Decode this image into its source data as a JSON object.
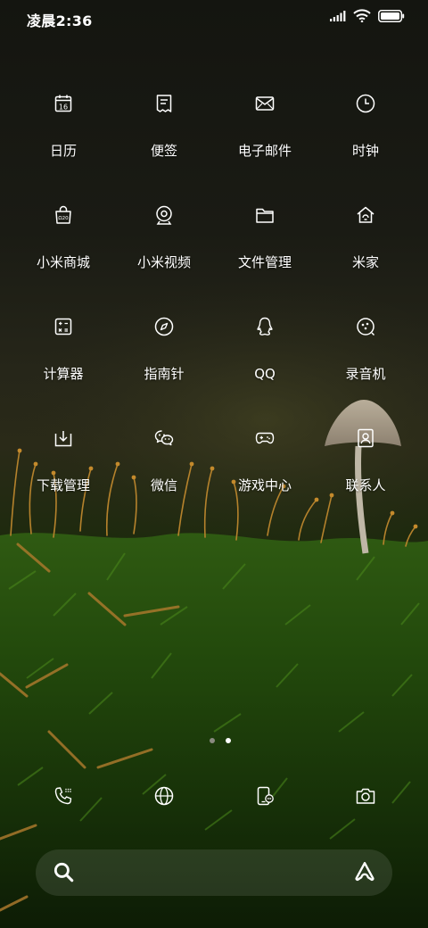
{
  "status_bar": {
    "time": "凌晨2:36",
    "icons": [
      "signal-icon",
      "wifi-icon",
      "battery-icon"
    ]
  },
  "apps": [
    {
      "label": "日历",
      "icon": "calendar-icon",
      "calendar_day": "16"
    },
    {
      "label": "便签",
      "icon": "notes-icon"
    },
    {
      "label": "电子邮件",
      "icon": "mail-icon"
    },
    {
      "label": "时钟",
      "icon": "clock-icon"
    },
    {
      "label": "小米商城",
      "icon": "mi-store-icon",
      "store_tag": "Ω20"
    },
    {
      "label": "小米视频",
      "icon": "video-icon"
    },
    {
      "label": "文件管理",
      "icon": "folder-icon"
    },
    {
      "label": "米家",
      "icon": "mi-home-icon"
    },
    {
      "label": "计算器",
      "icon": "calculator-icon"
    },
    {
      "label": "指南针",
      "icon": "compass-icon"
    },
    {
      "label": "QQ",
      "icon": "qq-penguin-icon"
    },
    {
      "label": "录音机",
      "icon": "recorder-icon"
    },
    {
      "label": "下载管理",
      "icon": "download-icon"
    },
    {
      "label": "微信",
      "icon": "wechat-icon"
    },
    {
      "label": "游戏中心",
      "icon": "gamepad-icon"
    },
    {
      "label": "联系人",
      "icon": "contacts-icon"
    }
  ],
  "page_indicator": {
    "pages": 2,
    "current": 2
  },
  "dock": [
    "phone-icon",
    "browser-icon",
    "messages-icon",
    "camera-icon"
  ],
  "search_bar": {
    "left_icon": "search-icon",
    "right_icon": "assistant-icon"
  },
  "colors": {
    "text": "#ffffff",
    "dot_active": "#ffffff",
    "dot_inactive": "#8a8a80"
  }
}
